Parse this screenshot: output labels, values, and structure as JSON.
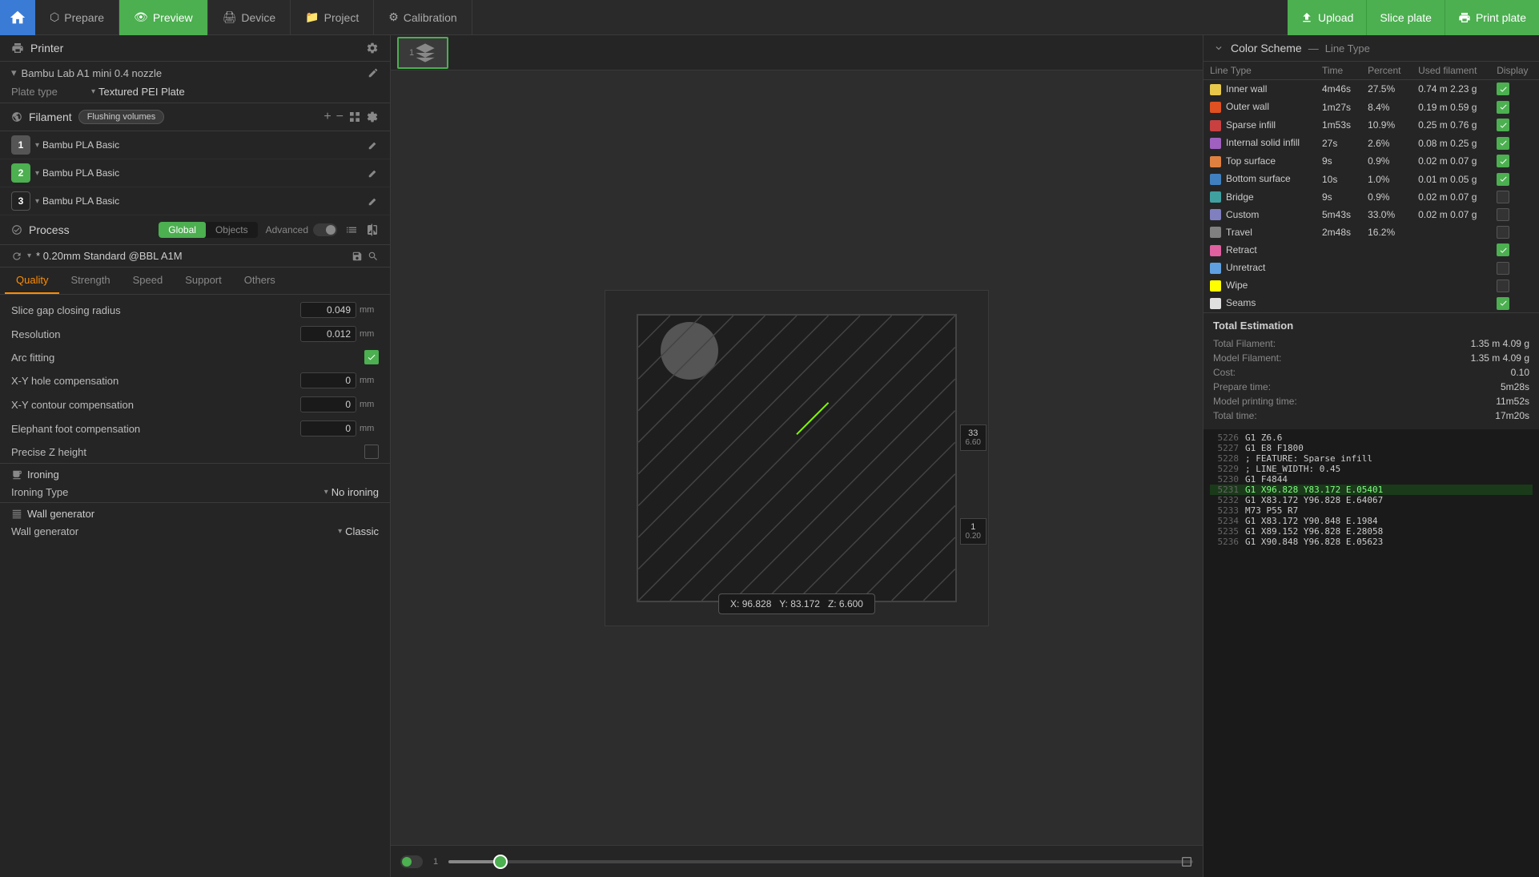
{
  "nav": {
    "home_icon": "🏠",
    "tabs": [
      {
        "label": "Prepare",
        "icon": "⬡",
        "active": false
      },
      {
        "label": "Preview",
        "icon": "👁",
        "active": true
      },
      {
        "label": "Device",
        "icon": "🖨",
        "active": false
      },
      {
        "label": "Project",
        "icon": "📁",
        "active": false
      },
      {
        "label": "Calibration",
        "icon": "⚙",
        "active": false
      }
    ],
    "upload_label": "Upload",
    "slice_label": "Slice plate",
    "print_label": "Print plate"
  },
  "printer": {
    "section_label": "Printer",
    "printer_name": "Bambu Lab A1 mini 0.4 nozzle",
    "plate_type_label": "Plate type",
    "plate_type_value": "Textured PEI Plate"
  },
  "filament": {
    "section_label": "Filament",
    "flushing_badge": "Flushing volumes",
    "items": [
      {
        "num": "1",
        "name": "Bambu PLA Basic"
      },
      {
        "num": "2",
        "name": "Bambu PLA Basic"
      },
      {
        "num": "3",
        "name": "Bambu PLA Basic"
      }
    ]
  },
  "process": {
    "section_label": "Process",
    "toggle_global": "Global",
    "toggle_objects": "Objects",
    "advanced_label": "Advanced",
    "profile_name": "* 0.20mm Standard @BBL A1M",
    "tabs": [
      "Quality",
      "Strength",
      "Speed",
      "Support",
      "Others"
    ],
    "active_tab": "Quality"
  },
  "quality_settings": [
    {
      "label": "Slice gap closing radius",
      "value": "0.049",
      "unit": "mm"
    },
    {
      "label": "Resolution",
      "value": "0.012",
      "unit": "mm"
    },
    {
      "label": "Arc fitting",
      "value": "checkbox_checked",
      "unit": ""
    },
    {
      "label": "X-Y hole compensation",
      "value": "0",
      "unit": "mm"
    },
    {
      "label": "X-Y contour compensation",
      "value": "0",
      "unit": "mm"
    },
    {
      "label": "Elephant foot compensation",
      "value": "0",
      "unit": "mm"
    },
    {
      "label": "Precise Z height",
      "value": "checkbox_empty",
      "unit": ""
    }
  ],
  "ironing": {
    "label": "Ironing",
    "ironing_type_label": "Ironing Type",
    "ironing_type_value": "No ironing"
  },
  "wall_generator": {
    "label": "Wall generator",
    "wall_gen_label": "Wall generator",
    "wall_gen_value": "Classic"
  },
  "color_scheme": {
    "title": "Color Scheme",
    "separator": "—",
    "type_label": "Line Type",
    "cols": [
      "Line Type",
      "Time",
      "Percent",
      "Used filament",
      "Display"
    ],
    "rows": [
      {
        "color": "#e8c84a",
        "label": "Inner wall",
        "time": "4m46s",
        "percent": "27.5%",
        "filament": "0.74 m 2.23 g",
        "checked": true
      },
      {
        "color": "#e05020",
        "label": "Outer wall",
        "time": "1m27s",
        "percent": "8.4%",
        "filament": "0.19 m 0.59 g",
        "checked": true
      },
      {
        "color": "#c84040",
        "label": "Sparse infill",
        "time": "1m53s",
        "percent": "10.9%",
        "filament": "0.25 m 0.76 g",
        "checked": true
      },
      {
        "color": "#a060c0",
        "label": "Internal solid infill",
        "time": "27s",
        "percent": "2.6%",
        "filament": "0.08 m 0.25 g",
        "checked": true
      },
      {
        "color": "#e08040",
        "label": "Top surface",
        "time": "9s",
        "percent": "0.9%",
        "filament": "0.02 m 0.07 g",
        "checked": true
      },
      {
        "color": "#4080c0",
        "label": "Bottom surface",
        "time": "10s",
        "percent": "1.0%",
        "filament": "0.01 m 0.05 g",
        "checked": true
      },
      {
        "color": "#40a0a0",
        "label": "Bridge",
        "time": "9s",
        "percent": "0.9%",
        "filament": "0.02 m 0.07 g",
        "checked": false
      },
      {
        "color": "#8080c0",
        "label": "Custom",
        "time": "5m43s",
        "percent": "33.0%",
        "filament": "0.02 m 0.07 g",
        "checked": false
      },
      {
        "color": "#808080",
        "label": "Travel",
        "time": "2m48s",
        "percent": "16.2%",
        "filament": "",
        "checked": false
      },
      {
        "color": "#e060a0",
        "label": "Retract",
        "time": "",
        "percent": "",
        "filament": "",
        "checked": true
      },
      {
        "color": "#60a0e0",
        "label": "Unretract",
        "time": "",
        "percent": "",
        "filament": "",
        "checked": false
      },
      {
        "color": "#ffff00",
        "label": "Wipe",
        "time": "",
        "percent": "",
        "filament": "",
        "checked": false
      },
      {
        "color": "#e0e0e0",
        "label": "Seams",
        "time": "",
        "percent": "",
        "filament": "",
        "checked": true
      }
    ]
  },
  "estimation": {
    "title": "Total Estimation",
    "rows": [
      {
        "label": "Total Filament:",
        "value": "1.35 m  4.09 g"
      },
      {
        "label": "Model Filament:",
        "value": "1.35 m  4.09 g"
      },
      {
        "label": "Cost:",
        "value": "0.10"
      },
      {
        "label": "Prepare time:",
        "value": "5m28s"
      },
      {
        "label": "Model printing time:",
        "value": "11m52s"
      },
      {
        "label": "Total time:",
        "value": "17m20s"
      }
    ]
  },
  "gcode": {
    "lines": [
      {
        "num": "5226",
        "text": "G1 Z6.6",
        "highlight": false
      },
      {
        "num": "5227",
        "text": "G1 E8 F1800",
        "highlight": false
      },
      {
        "num": "5228",
        "text": "; FEATURE: Sparse infill",
        "highlight": false
      },
      {
        "num": "5229",
        "text": "; LINE_WIDTH: 0.45",
        "highlight": false
      },
      {
        "num": "5230",
        "text": "G1 F4844",
        "highlight": false
      },
      {
        "num": "5231",
        "text": "G1 X96.828 Y83.172 E.05401",
        "highlight": true
      },
      {
        "num": "5232",
        "text": "G1 X83.172 Y96.828 E.64067",
        "highlight": false
      },
      {
        "num": "5233",
        "text": "M73 P55 R7",
        "highlight": false
      },
      {
        "num": "5234",
        "text": "G1 X83.172 Y90.848 E.1984",
        "highlight": false
      },
      {
        "num": "5235",
        "text": "G1 X89.152 Y96.828 E.28058",
        "highlight": false
      },
      {
        "num": "5236",
        "text": "G1 X90.848 Y96.828 E.05623",
        "highlight": false
      }
    ]
  },
  "coords": {
    "x": "X: 96.828",
    "y": "Y: 83.172",
    "z": "Z: 6.600"
  },
  "layer": {
    "num1": "33",
    "num2": "6.60",
    "num3": "1",
    "num4": "0.20"
  }
}
